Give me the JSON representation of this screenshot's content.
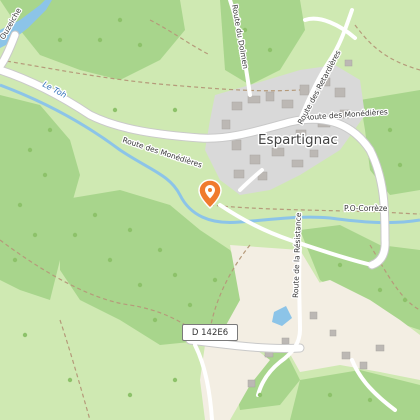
{
  "map": {
    "town": "Espartignac",
    "roads": {
      "route_monedieres_west": "Route des Monédières",
      "route_monedieres_east": "Route des Monédières",
      "route_retardieres": "Route des Retardières",
      "route_dolmen": "Route du Dolmen",
      "route_resistance": "Route de la Résistance",
      "ouzeiche": "Ouzeiche",
      "d142e6": "D 142E6"
    },
    "waterway": "Le Toh",
    "trail": "P.O-Corrèze",
    "marker_icon": "location-pin-icon",
    "colors": {
      "forest": "#a8d58c",
      "meadow": "#cfe9b2",
      "farmland": "#f3eee3",
      "urban": "#d9d9d9",
      "building": "#bcb8b4",
      "water": "#8cc4e8",
      "road": "#ffffff",
      "marker": "#f07a2e"
    }
  }
}
